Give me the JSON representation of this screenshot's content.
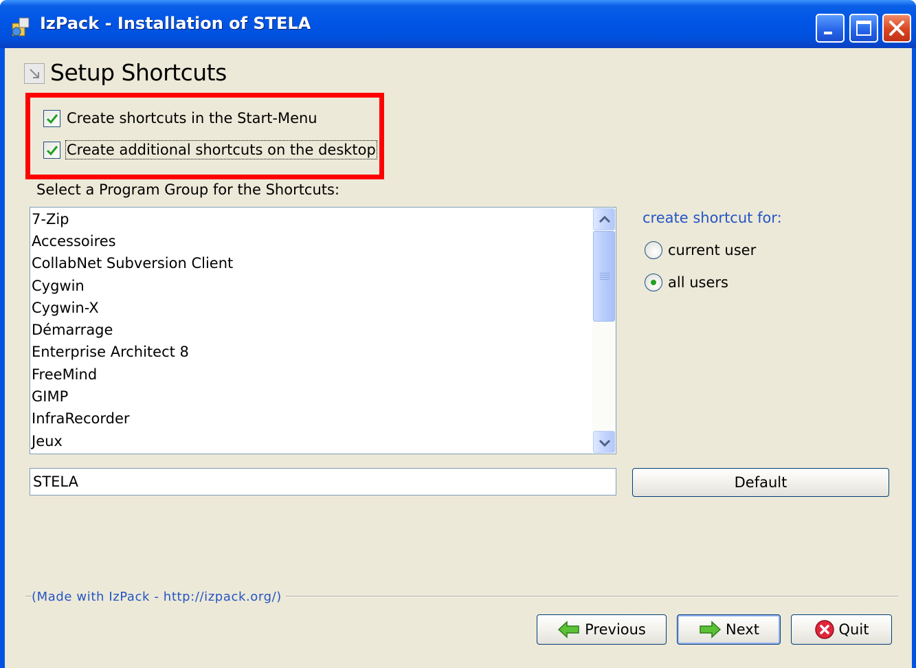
{
  "window": {
    "title": "IzPack - Installation of STELA"
  },
  "panel": {
    "title": "Setup Shortcuts"
  },
  "options": {
    "start_menu": {
      "label": "Create shortcuts in the Start-Menu",
      "checked": true
    },
    "desktop": {
      "label": "Create additional shortcuts on the desktop",
      "checked": true
    }
  },
  "program_group": {
    "label": "Select a Program Group for the Shortcuts:",
    "items": [
      "7-Zip",
      "Accessoires",
      "CollabNet Subversion Client",
      "Cygwin",
      "Cygwin-X",
      "Démarrage",
      "Enterprise Architect 8",
      "FreeMind",
      "GIMP",
      "InfraRecorder",
      "Jeux"
    ],
    "value": "STELA",
    "default_button": "Default"
  },
  "shortcut_for": {
    "label": "create shortcut for:",
    "options": [
      {
        "label": "current user",
        "selected": false
      },
      {
        "label": "all users",
        "selected": true
      }
    ]
  },
  "footer": {
    "credit": "(Made with IzPack - http://izpack.org/)",
    "previous": "Previous",
    "next": "Next",
    "quit": "Quit"
  },
  "colors": {
    "titlebar": "#0054e3",
    "highlight_box": "#ff0000",
    "link_text": "#2454c4",
    "client_bg": "#ece9d8"
  }
}
